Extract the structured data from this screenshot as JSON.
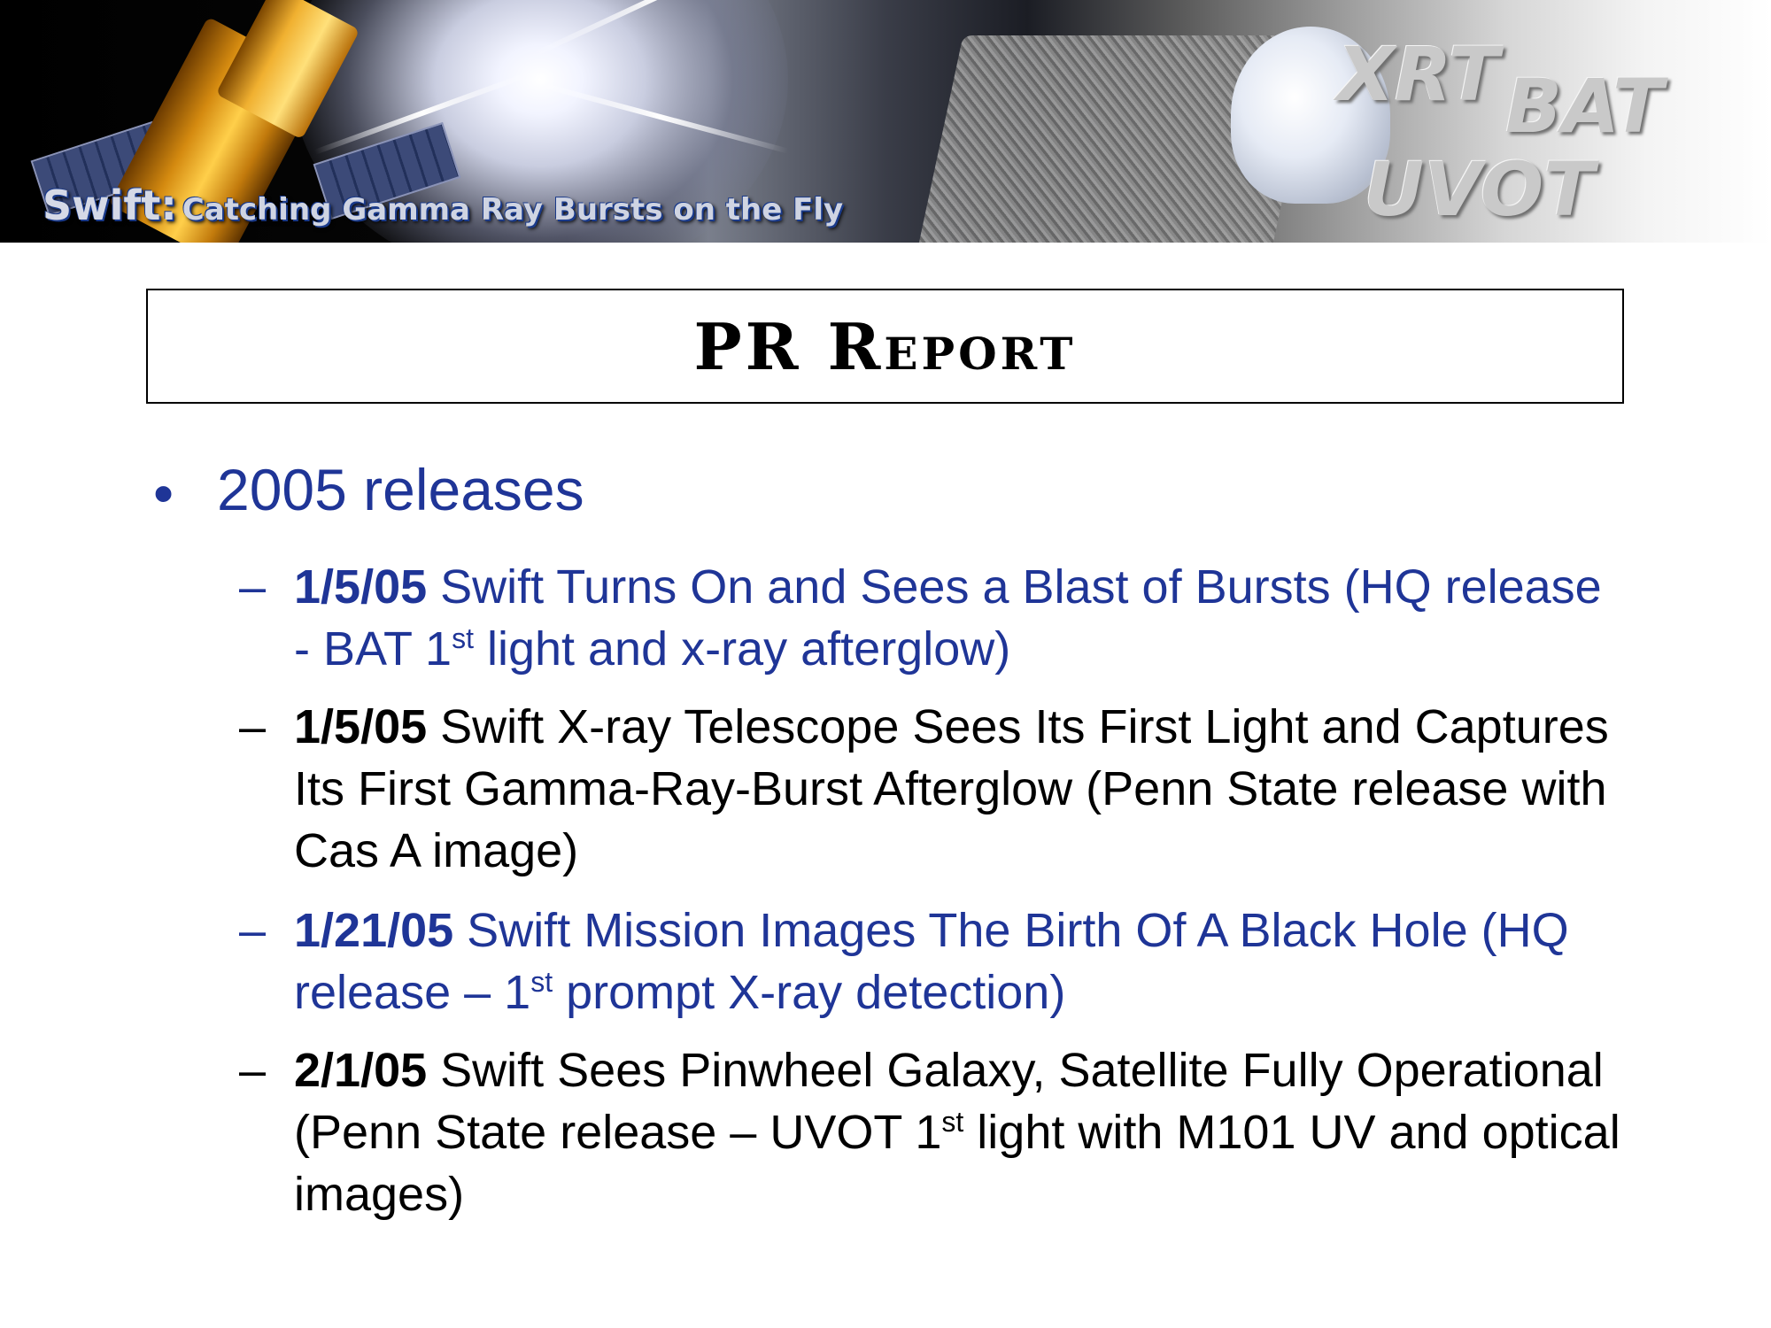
{
  "banner": {
    "brand": "Swift:",
    "tagline": "Catching Gamma Ray Bursts on the Fly",
    "instruments": [
      "XRT",
      "BAT",
      "UVOT"
    ]
  },
  "slide": {
    "title": "PR Report",
    "main_bullet": "2005 releases",
    "releases": [
      {
        "date": "1/5/05",
        "text_a": " Swift Turns On and Sees a Blast of Bursts (HQ release - BAT 1",
        "sup": "st",
        "text_b": " light and x-ray afterglow)",
        "color": "#1f3597"
      },
      {
        "date": "1/5/05",
        "text_a": " Swift X-ray Telescope Sees Its First Light and Captures Its First Gamma-Ray-Burst Afterglow (Penn State release with Cas A image)",
        "sup": "",
        "text_b": "",
        "color": "#000000"
      },
      {
        "date": "1/21/05",
        "text_a": " Swift Mission Images The Birth Of A Black Hole (HQ release – 1",
        "sup": "st",
        "text_b": " prompt X-ray detection)",
        "color": "#1f3597"
      },
      {
        "date": "2/1/05",
        "text_a": " Swift Sees Pinwheel Galaxy, Satellite Fully Operational (Penn State release – UVOT 1",
        "sup": "st",
        "text_b": " light with M101 UV and optical images)",
        "color": "#000000"
      }
    ]
  },
  "colors": {
    "accent_blue": "#1f3597",
    "text_black": "#000000"
  }
}
